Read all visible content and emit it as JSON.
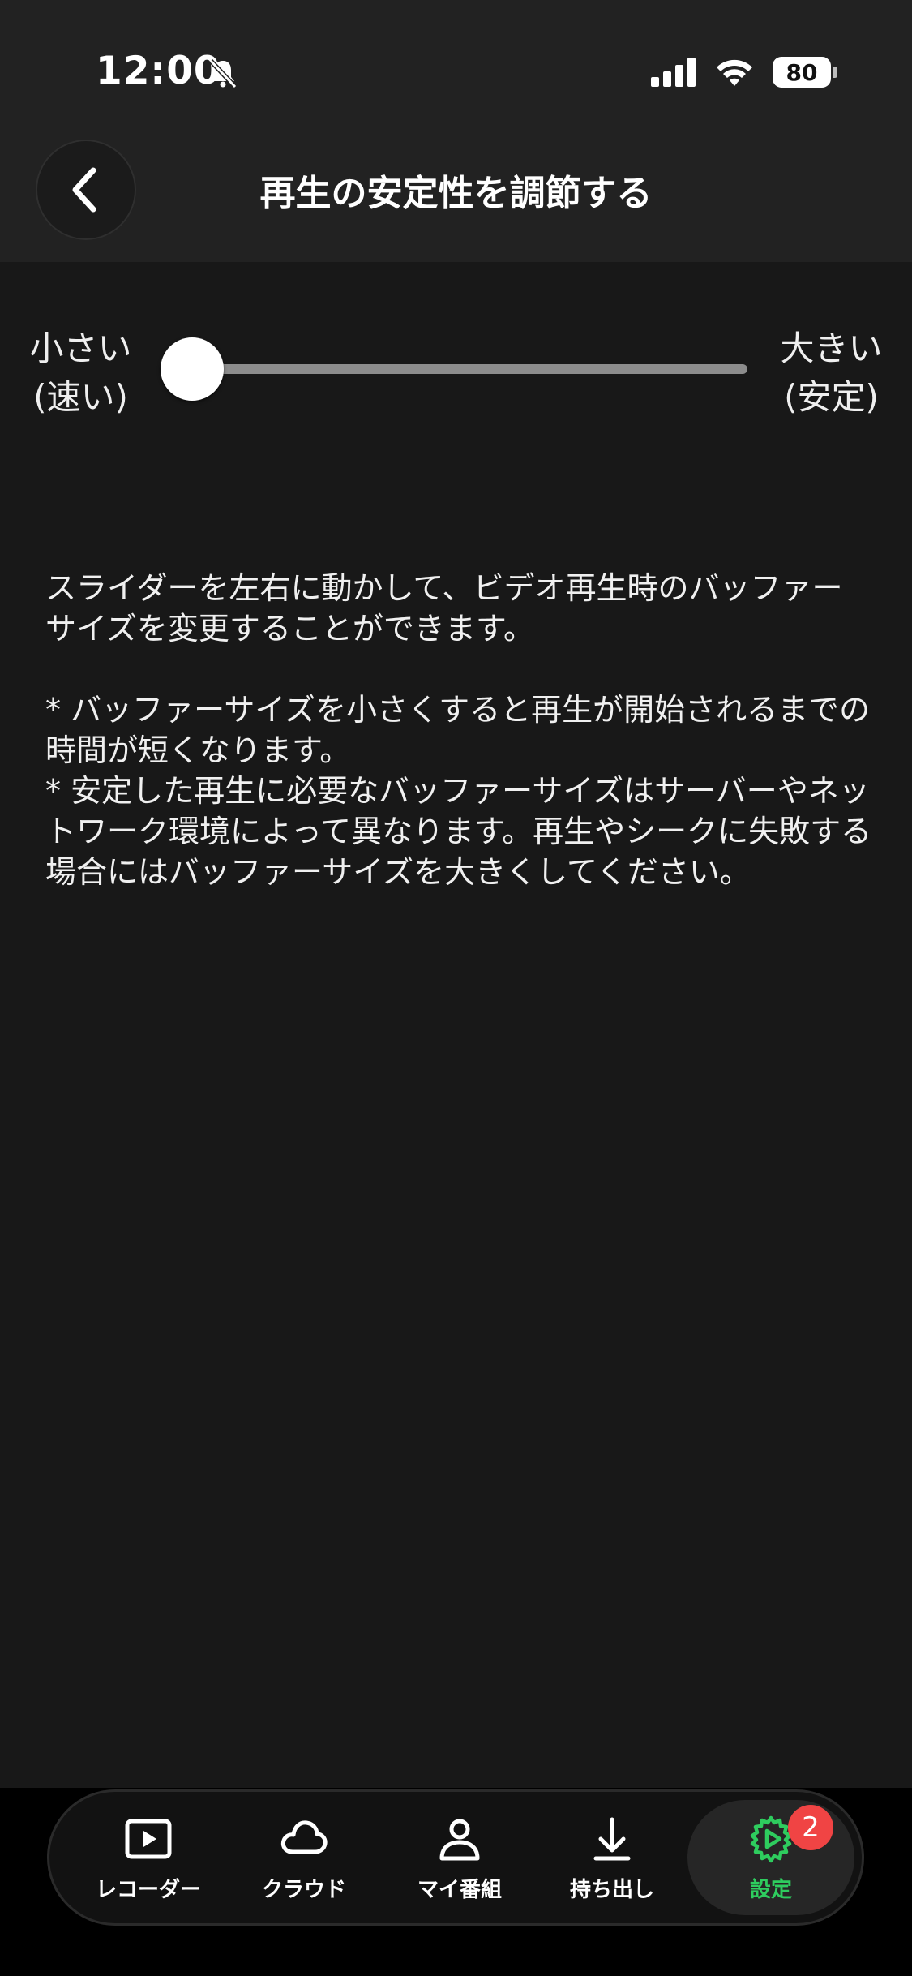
{
  "status_bar": {
    "time": "12:00",
    "battery": "80"
  },
  "header": {
    "title": "再生の安定性を調節する",
    "back_icon": "chevron-left-icon"
  },
  "slider": {
    "left_label": "小さい\n(速い)",
    "right_label": "大きい\n(安定)",
    "value_fraction": 0.0
  },
  "description": {
    "paragraph1": "スライダーを左右に動かして、ビデオ再生時のバッファーサイズを変更することができます。",
    "note1": "* バッファーサイズを小さくすると再生が開始されるまでの時間が短くなります。",
    "note2": "* 安定した再生に必要なバッファーサイズはサーバーやネットワーク環境によって異なります。再生やシークに失敗する場合にはバッファーサイズを大きくしてください。"
  },
  "tabs": [
    {
      "label": "レコーダー",
      "icon": "play-square-icon"
    },
    {
      "label": "クラウド",
      "icon": "cloud-icon"
    },
    {
      "label": "マイ番組",
      "icon": "person-icon"
    },
    {
      "label": "持ち出し",
      "icon": "download-icon"
    },
    {
      "label": "設定",
      "icon": "gear-icon",
      "badge": "2",
      "active": true
    }
  ],
  "colors": {
    "accent": "#2ecc5e",
    "badge": "#f04444",
    "background": "#181818"
  }
}
